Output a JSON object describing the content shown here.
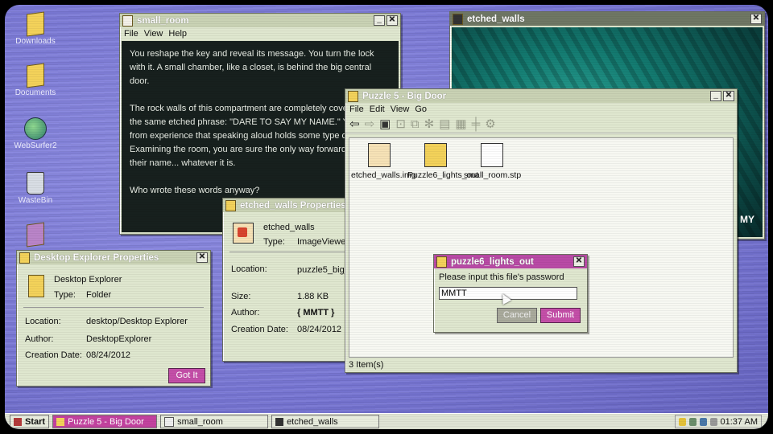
{
  "desktop_icons": [
    {
      "label": "Downloads"
    },
    {
      "label": "Documents"
    },
    {
      "label": "WebSurfer2"
    },
    {
      "label": "WasteBin"
    }
  ],
  "small_room_window": {
    "title": "small_room",
    "menu": [
      "File",
      "View",
      "Help"
    ],
    "paragraphs": [
      "You reshape the key and reveal its message. You turn the lock with it. A small chamber, like a closet, is behind the big central door.",
      "The rock walls of this compartment are completely covered with the same etched phrase: \"DARE TO SAY MY NAME.\" You know from experience that speaking aloud holds some type of power. Examining the room, you are sure the only way forward is to call their name... whatever it is.",
      "Who wrote these words anyway?"
    ]
  },
  "etched_walls_window": {
    "title": "etched_walls",
    "overlay_text": "MY"
  },
  "big_door_window": {
    "title": "Puzzle 5 - Big Door",
    "menu": [
      "File",
      "Edit",
      "View",
      "Go"
    ],
    "files": [
      {
        "label": "etched_walls.img"
      },
      {
        "label": "Puzzle6_lights_out"
      },
      {
        "label": "small_room.stp"
      }
    ],
    "status": "3 Item(s)"
  },
  "etched_props": {
    "title": "etched_walls Properties",
    "name": "etched_walls",
    "type_label": "Type:",
    "type_value": "ImageViewer",
    "location_label": "Location:",
    "location_value": "puzzle5_big_d...s",
    "size_label": "Size:",
    "size_value": "1.88 KB",
    "author_label": "Author:",
    "author_value": "{ MMTT }",
    "date_label": "Creation Date:",
    "date_value": "08/24/2012"
  },
  "explorer_props": {
    "title": "Desktop Explorer Properties",
    "name": "Desktop Explorer",
    "type_label": "Type:",
    "type_value": "Folder",
    "location_label": "Location:",
    "location_value": "desktop/Desktop Explorer",
    "author_label": "Author:",
    "author_value": "DesktopExplorer",
    "date_label": "Creation Date:",
    "date_value": "08/24/2012",
    "button": "Got It"
  },
  "password_dialog": {
    "title": "puzzle6_lights_out",
    "prompt": "Please input this file's password",
    "input_value": "MMTT",
    "cancel": "Cancel",
    "submit": "Submit"
  },
  "taskbar": {
    "start": "Start",
    "tasks": [
      {
        "label": "Puzzle 5 - Big Door"
      },
      {
        "label": "small_room"
      },
      {
        "label": "etched_walls"
      }
    ],
    "clock": "01:37 AM"
  },
  "colors": {
    "accent": "#c3429f",
    "window_bg": "#dfe7cf",
    "desktop": "#7b79d8"
  }
}
